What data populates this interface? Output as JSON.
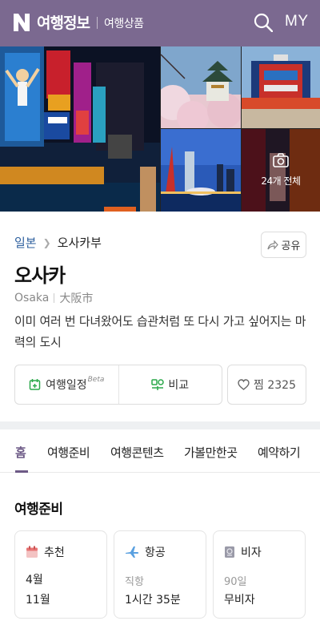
{
  "header": {
    "logo": "N",
    "title": "여행정보",
    "subtitle": "여행상품",
    "my_label": "MY",
    "icons": [
      "naver-n-logo",
      "search-icon"
    ]
  },
  "gallery": {
    "count_label": "24개 전체",
    "icon": "camera-icon"
  },
  "info": {
    "breadcrumb": [
      "일본",
      "오사카부"
    ],
    "share_label": "공유",
    "title": "오사카",
    "name_en": "Osaka",
    "name_ja": "大阪市",
    "description": "이미 여러 번 다녀왔어도 습관처럼 또 다시 가고 싶어지는 마력의 도시",
    "schedule_label": "여행일정",
    "beta_label": "Beta",
    "compare_label": "비교",
    "pick_label": "찜 2325"
  },
  "tabs": {
    "items": [
      "홈",
      "여행준비",
      "여행콘텐츠",
      "가볼만한곳",
      "예약하기"
    ],
    "active": 0
  },
  "prep": {
    "title": "여행준비",
    "cards": [
      {
        "icon": "calendar-icon",
        "label": "추천",
        "sub": "",
        "lines": [
          "4월",
          "11월"
        ]
      },
      {
        "icon": "airplane-icon",
        "label": "항공",
        "sub": "직항",
        "lines": [
          "1시간 35분"
        ]
      },
      {
        "icon": "passport-icon",
        "label": "비자",
        "sub": "90일",
        "lines": [
          "무비자"
        ]
      }
    ]
  },
  "colors": {
    "header_bg": "#7b6990",
    "accent": "#6d5a86",
    "breadcrumb_link": "#2d5f9e",
    "green_icon": "#2aa84a"
  }
}
